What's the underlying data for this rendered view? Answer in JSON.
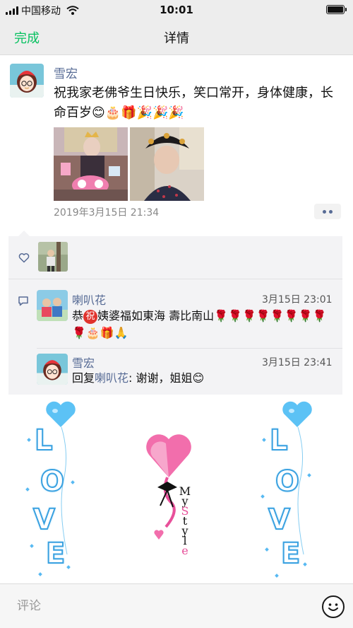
{
  "status_bar": {
    "carrier": "中国移动",
    "time": "10:01"
  },
  "nav": {
    "done_label": "完成",
    "title": "详情"
  },
  "post": {
    "author": "雪宏",
    "text": "祝我家老佛爷生日快乐，笑口常开，身体健康，长命百岁😊🎂🎁🎉🎉🎉",
    "timestamp": "2019年3月15日 21:34",
    "photos": [
      "grandmother-cake-photo",
      "grandmother-portrait-photo"
    ]
  },
  "likes": {
    "icon": "heart-outline-icon"
  },
  "comments": [
    {
      "name": "喇叭花",
      "time": "3月15日 23:01",
      "text_prefix": "恭",
      "badge": "祝",
      "text_suffix": "姨婆福如東海 壽比南山🌹🌹🌹🌹🌹🌹🌹🌹🌹🎂🎁🙏"
    },
    {
      "name": "雪宏",
      "time": "3月15日 23:41",
      "reply_prefix": "回复",
      "reply_to": "喇叭花",
      "text": ": 谢谢，姐姐😊"
    }
  ],
  "decoration": {
    "left_word": [
      "L",
      "O",
      "V",
      "E"
    ],
    "right_word": [
      "L",
      "O",
      "V",
      "E"
    ],
    "center_text": [
      "M",
      "y",
      "S",
      "t",
      "y",
      "l",
      "e"
    ]
  },
  "input": {
    "placeholder": "评论"
  },
  "colors": {
    "accent_green": "#07c160",
    "link_blue": "#576b95",
    "badge_red": "#e0332d",
    "love_blue": "#3aa1e0",
    "pink": "#f06aa8"
  }
}
